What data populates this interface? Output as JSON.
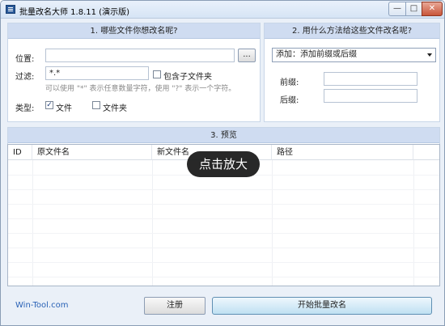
{
  "window": {
    "title": "批量改名大师 1.8.11 (演示版)",
    "minimize_glyph": "—",
    "maximize_glyph": "□",
    "close_glyph": "✕"
  },
  "panel1": {
    "heading": "1. 哪些文件你想改名呢?",
    "location_label": "位置:",
    "location_value": "",
    "browse_label": "...",
    "filter_label": "过滤:",
    "filter_value": "*.*",
    "include_subfolders_label": "包含子文件夹",
    "include_subfolders_checked": false,
    "filter_hint": "可以使用 \"*\" 表示任意数量字符，使用 \"?\" 表示一个字符。",
    "type_label": "类型:",
    "type_file_label": "文件",
    "type_file_checked": true,
    "type_folder_label": "文件夹",
    "type_folder_checked": false
  },
  "panel2": {
    "heading": "2. 用什么方法给这些文件改名呢?",
    "method_selected": "添加：添加前缀或后缀",
    "prefix_label": "前缀:",
    "prefix_value": "",
    "suffix_label": "后缀:",
    "suffix_value": ""
  },
  "preview": {
    "heading": "3. 预览",
    "columns": [
      "ID",
      "原文件名",
      "新文件名",
      "路径"
    ]
  },
  "overlay": {
    "label": "点击放大"
  },
  "footer": {
    "site_link": "Win-Tool.com",
    "register_label": "注册",
    "start_label": "开始批量改名"
  },
  "colors": {
    "panel_header": "#cfdcf1",
    "window_bg": "#eaf0f8",
    "link": "#2a62b6",
    "start_button": "#bfe0f2"
  }
}
